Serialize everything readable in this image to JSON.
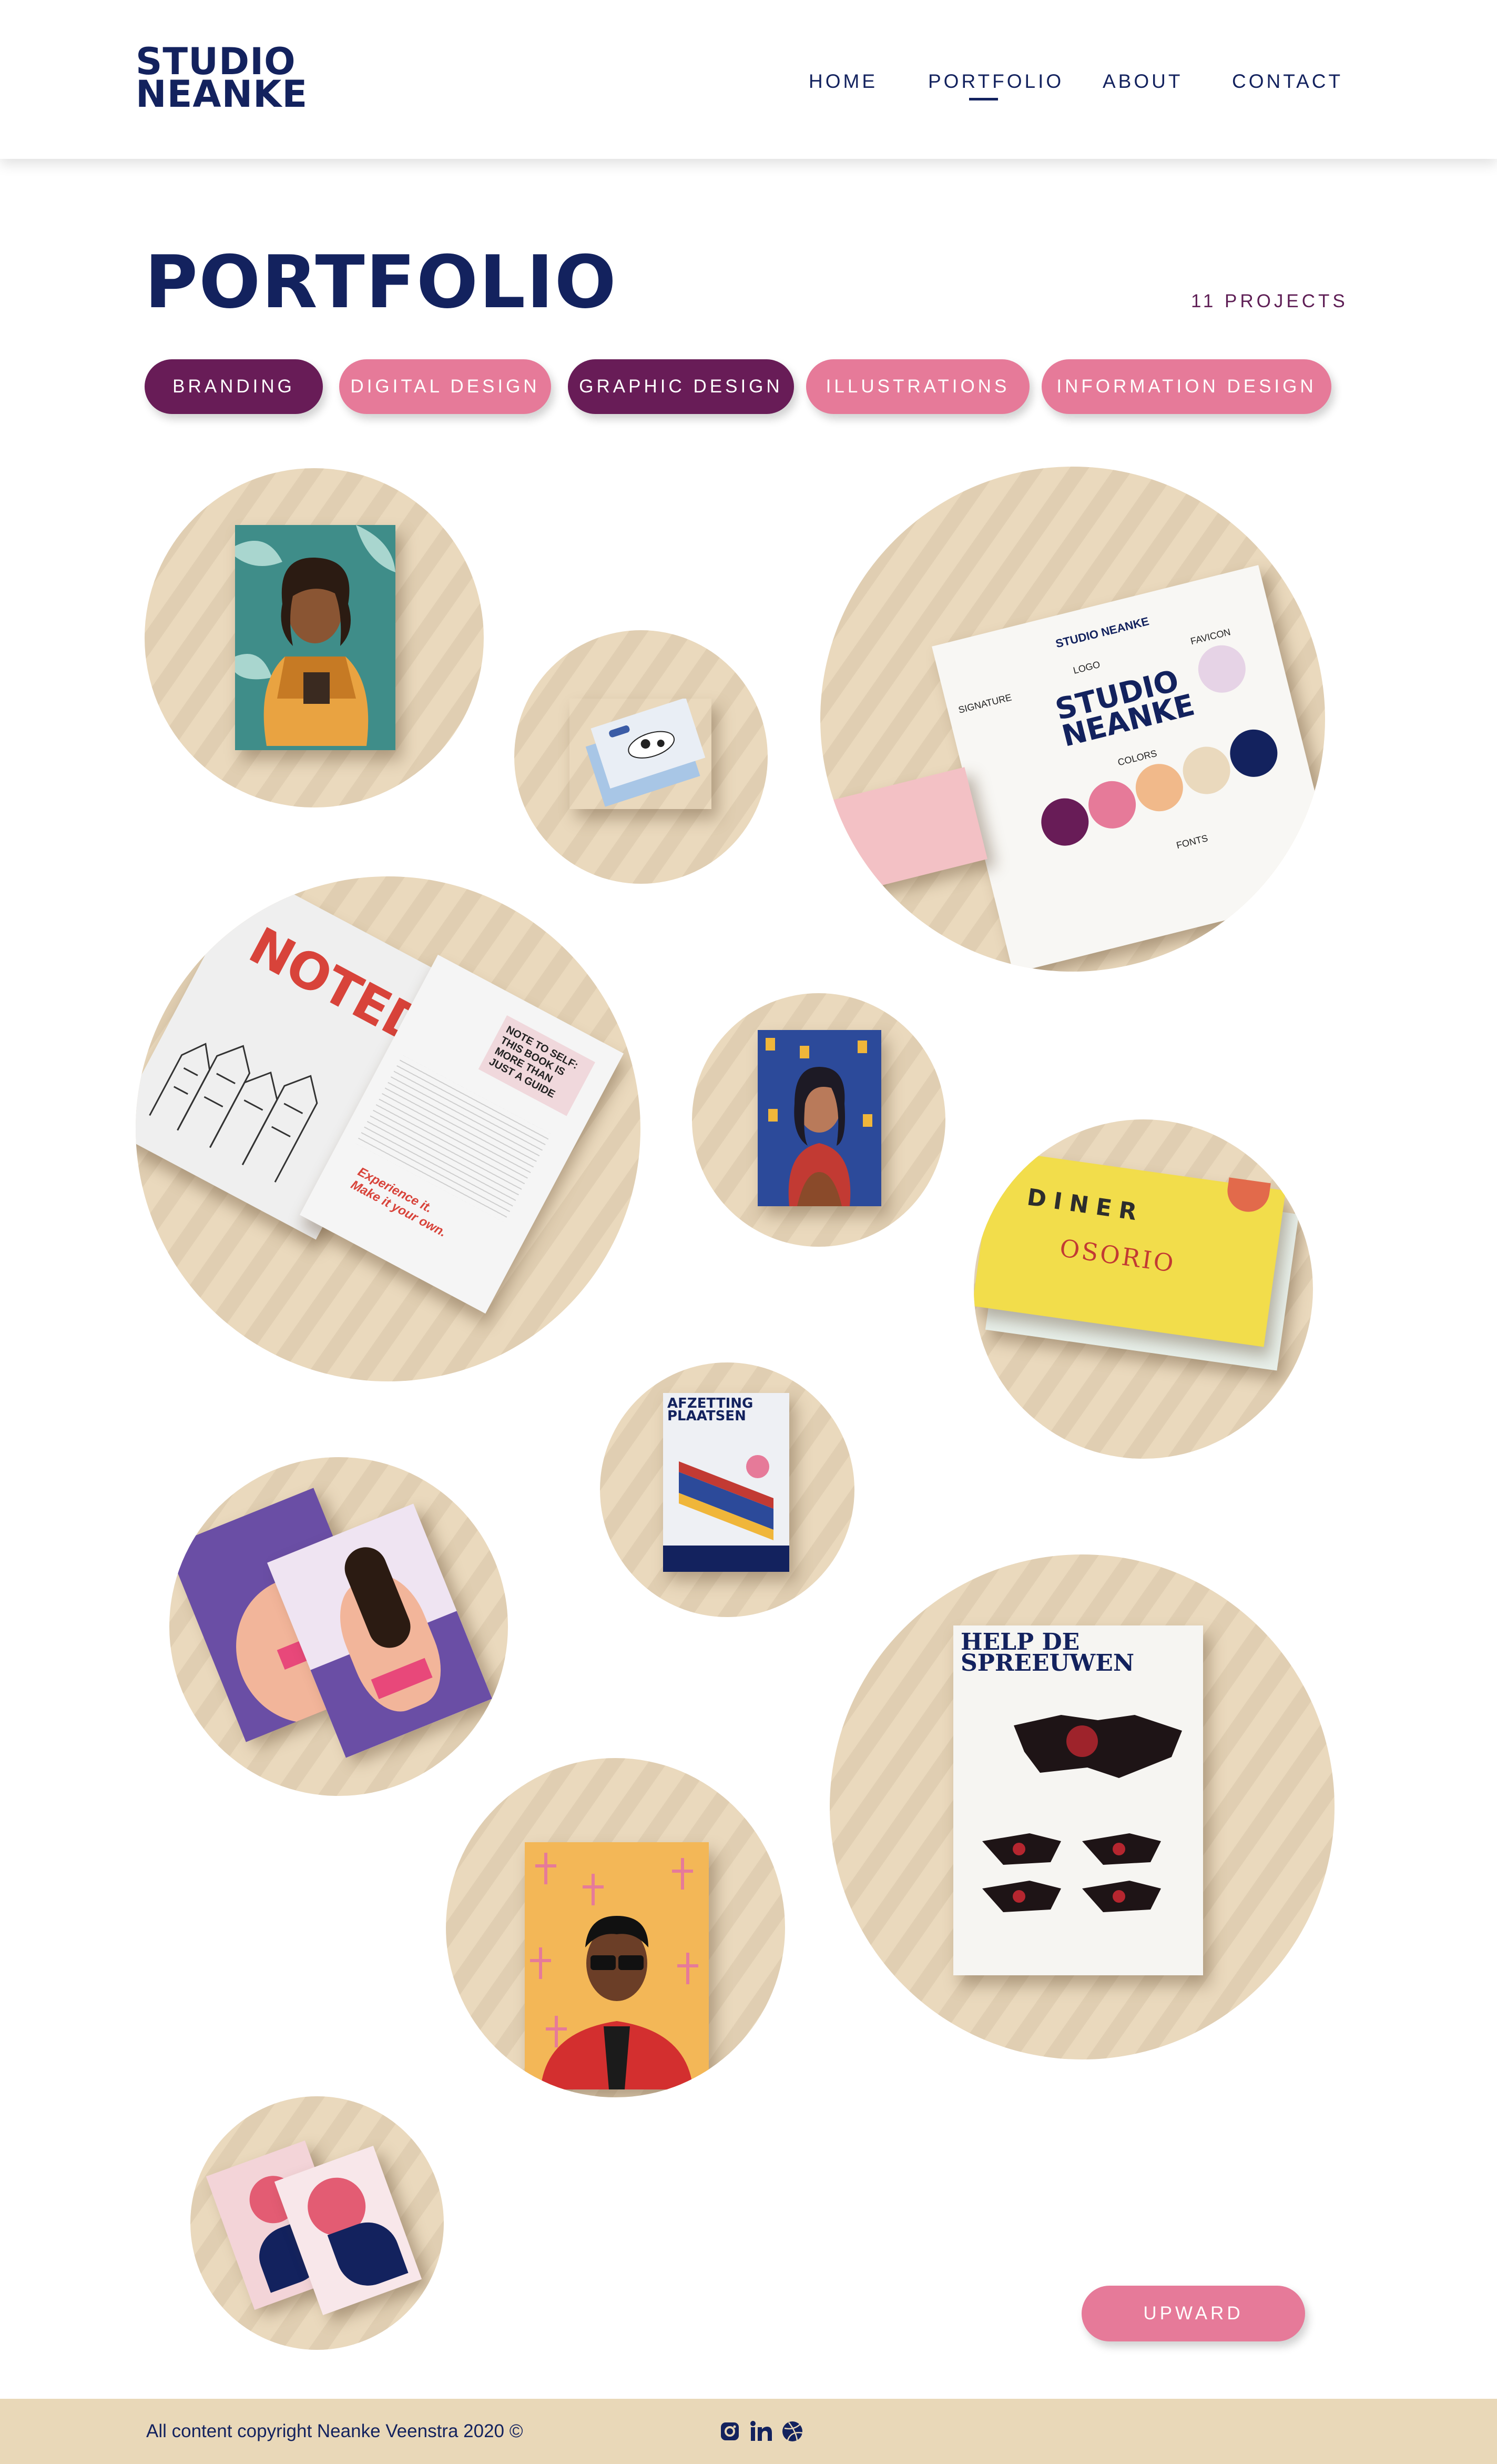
{
  "brand": {
    "line1": "STUDIO",
    "line2": "NEANKE"
  },
  "nav": {
    "home": "HOME",
    "portfolio": "PORTFOLIO",
    "about": "ABOUT",
    "contact": "CONTACT",
    "active": "PORTFOLIO"
  },
  "page": {
    "title": "PORTFOLIO",
    "count": "11 PROJECTS"
  },
  "filters": [
    {
      "label": "BRANDING",
      "state": "selected"
    },
    {
      "label": "DIGITAL DESIGN",
      "state": "unselected"
    },
    {
      "label": "GRAPHIC DESIGN",
      "state": "selected"
    },
    {
      "label": "ILLUSTRATIONS",
      "state": "unselected"
    },
    {
      "label": "INFORMATION DESIGN",
      "state": "unselected"
    }
  ],
  "projects": {
    "noted": {
      "title": "NOTED.",
      "tagline": "Experience it. Make it your own.",
      "note": "NOTE TO SELF: THIS BOOK IS MORE THAN JUST A GUIDE"
    },
    "styleguide": {
      "line1": "STUDIO",
      "line2": "NEANKE",
      "signature": "SIGNATURE",
      "logo": "LOGO",
      "favicon": "FAVICON",
      "colors": "COLORS",
      "fonts": "FONTS",
      "heading": "STUDIO NEANKE"
    },
    "diner": {
      "line1": "DINER",
      "line2": "OSORIO"
    },
    "afzetting": {
      "line1": "AFZETTING",
      "line2": "PLAATSEN"
    },
    "spreeuwen": {
      "line1": "HELP DE",
      "line2": "SPREEUWEN"
    }
  },
  "upward": "UPWARD",
  "footer": {
    "copyright": "All content copyright Neanke Veenstra 2020 ©"
  },
  "social": [
    "instagram-icon",
    "linkedin-icon",
    "dribbble-icon"
  ],
  "colors": {
    "navy": "#13225e",
    "plum": "#681c57",
    "pink": "#e67a99",
    "sand": "#e9d8b8"
  }
}
